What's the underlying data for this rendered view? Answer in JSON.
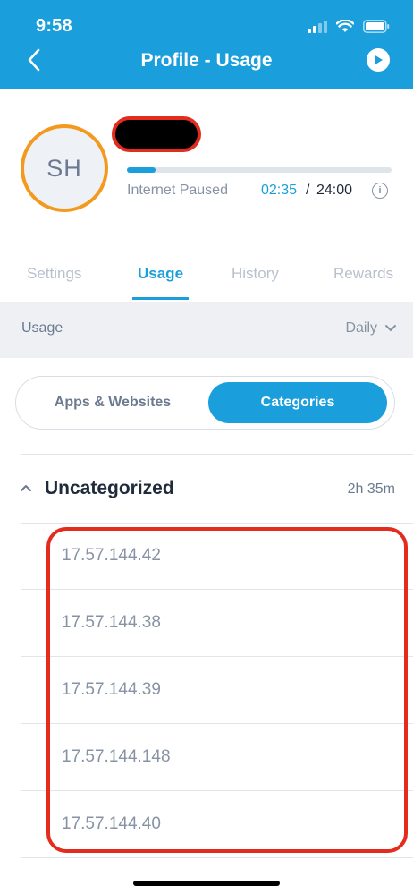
{
  "status_bar": {
    "time": "9:58"
  },
  "header": {
    "title": "Profile - Usage",
    "back_icon": "chevron-left-icon",
    "play_icon": "play-circle-icon"
  },
  "profile": {
    "initials": "SH",
    "status_text": "Internet Paused",
    "time_used": "02:35",
    "separator": "/",
    "time_limit": "24:00",
    "usage_fraction": 0.108
  },
  "tabs": [
    {
      "label": "Settings"
    },
    {
      "label": "Usage"
    },
    {
      "label": "History"
    },
    {
      "label": "Rewards"
    }
  ],
  "usage_section": {
    "label": "Usage",
    "period": "Daily"
  },
  "toggle": {
    "left": "Apps & Websites",
    "right": "Categories",
    "selected": "Categories"
  },
  "category": {
    "name": "Uncategorized",
    "duration": "2h 35m"
  },
  "items": [
    {
      "ip": "17.57.144.42"
    },
    {
      "ip": "17.57.144.38"
    },
    {
      "ip": "17.57.144.39"
    },
    {
      "ip": "17.57.144.148"
    },
    {
      "ip": "17.57.144.40"
    }
  ],
  "colors": {
    "accent": "#1a9fdc",
    "avatar_ring": "#f39a1e",
    "annotation": "#e32b1e"
  }
}
